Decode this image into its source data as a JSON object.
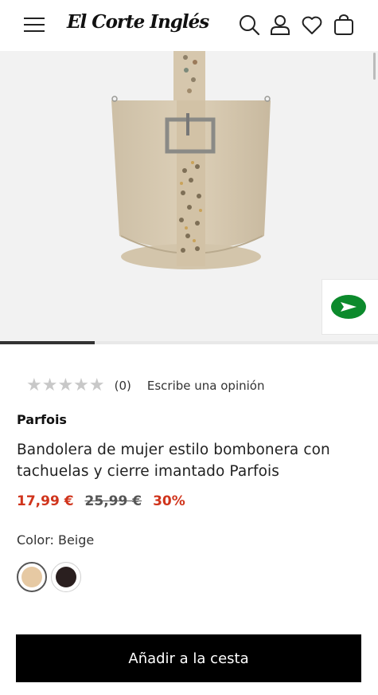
{
  "header": {
    "brand_logo_text": "El Corte Inglés"
  },
  "gallery": {
    "progress_fraction": 0.25
  },
  "rating": {
    "stars_glyphs": "★★★★★",
    "count": "(0)",
    "write_review": "Escribe una opinión"
  },
  "product": {
    "brand": "Parfois",
    "title": "Bandolera de mujer estilo bombonera con tachuelas y cierre imantado Parfois",
    "price_current": "17,99 €",
    "price_original": "25,99 €",
    "discount": "30%"
  },
  "color": {
    "label": "Color: Beige",
    "swatches": [
      {
        "name": "beige",
        "hex": "#e6c9a3",
        "selected": true
      },
      {
        "name": "black",
        "hex": "#2a1f1f",
        "selected": false
      }
    ]
  },
  "cta": {
    "add_to_cart": "Añadir a la cesta"
  },
  "colors": {
    "price_red": "#d0341c",
    "promo_green": "#0c8a2c",
    "cta_bg": "#000000"
  }
}
